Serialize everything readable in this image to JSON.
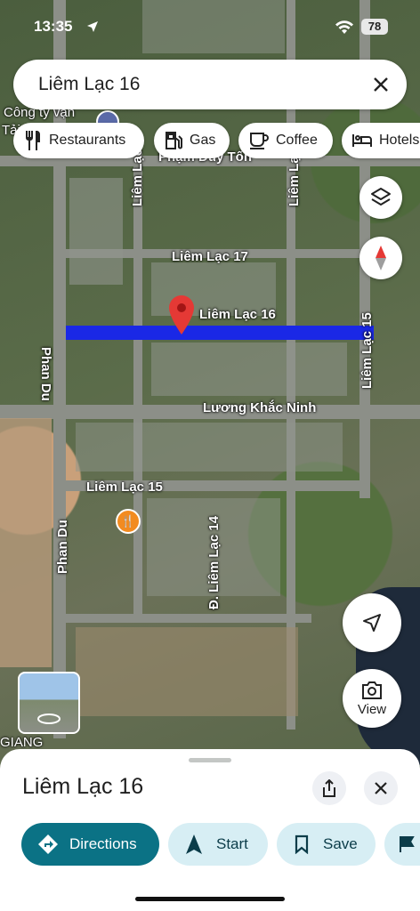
{
  "status_bar": {
    "time": "13:35",
    "battery": "78"
  },
  "search": {
    "query": "Liêm Lạc 16"
  },
  "chips": [
    {
      "label": "Restaurants",
      "icon": "fork-knife-icon"
    },
    {
      "label": "Gas",
      "icon": "gas-pump-icon"
    },
    {
      "label": "Coffee",
      "icon": "coffee-cup-icon"
    },
    {
      "label": "Hotels",
      "icon": "bed-icon"
    }
  ],
  "map": {
    "labels": {
      "lien_lac_17": "Liêm Lạc 17",
      "lien_lac_16": "Liêm Lạc 16",
      "luong_khac_ninh": "Lương Khắc Ninh",
      "lien_lac_15_h": "Liêm Lạc 15",
      "lien_lac_15_v": "Liêm Lạc 15",
      "phan_du_top": "Phan Du",
      "phan_du_bottom": "Phan Du",
      "lien_lac_14": "Đ. Liêm Lạc 14",
      "pham_duy_ton": "Phạm Duy Tốn",
      "cong_ty": "Công ty vận",
      "cong_ty_2": "Tải",
      "lien_top_v": "Liêm Lạc",
      "lien_top_v2": "Liêm Lạc",
      "giang": "GIANG"
    },
    "highlight_color": "#1a28e6",
    "pin_color": "#e53935"
  },
  "map_controls": {
    "view_label": "View"
  },
  "place_sheet": {
    "title": "Liêm Lạc 16",
    "actions": {
      "directions": "Directions",
      "start": "Start",
      "save": "Save"
    },
    "accent_color": "#0b7285"
  }
}
